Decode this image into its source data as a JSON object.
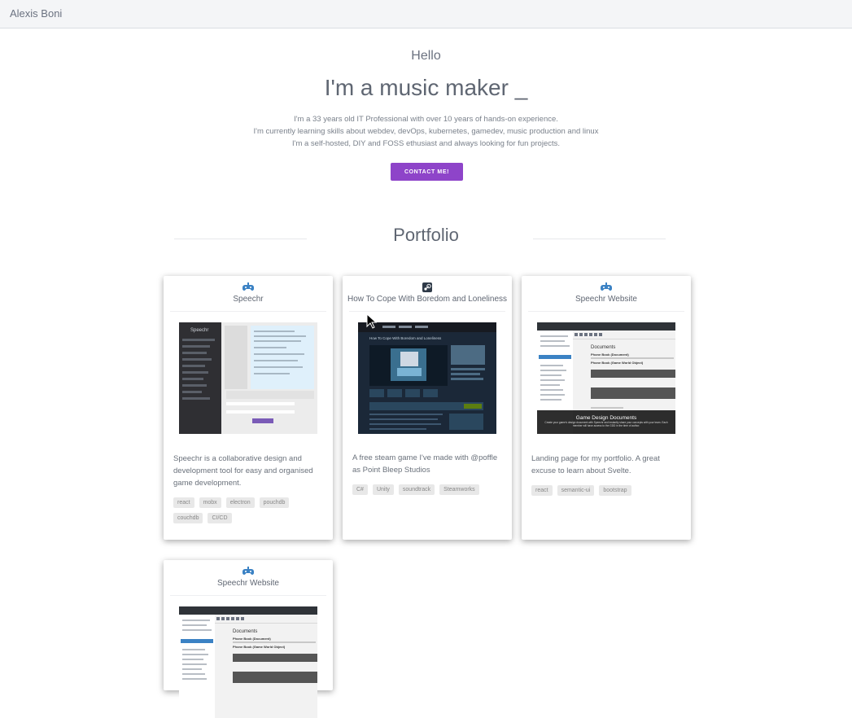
{
  "nav": {
    "brand": "Alexis Boni"
  },
  "hero": {
    "greeting": "Hello",
    "headline": "I'm a music maker _",
    "about": [
      "I'm a 33 years old IT Professional with over 10 years of hands-on experience.",
      "I'm currently learning skills about webdev, devOps, kubernetes, gamedev, music production and linux",
      "I'm a self-hosted, DIY and FOSS ethusiast and always looking for fun projects."
    ],
    "contact_label": "CONTACT ME!"
  },
  "portfolio": {
    "title": "Portfolio",
    "projects": [
      {
        "title": "Speechr",
        "icon": "gamepad-icon",
        "description": "Speechr is a collaborative design and development tool for easy and organised game development.",
        "tags": [
          "react",
          "mobx",
          "electron",
          "pouchdb",
          "couchdb",
          "CI/CD"
        ]
      },
      {
        "title": "How To Cope With Boredom and Loneliness",
        "icon": "steam-icon",
        "description": "A free steam game I've made with @poffle as Point Bleep Studios",
        "tags": [
          "C#",
          "Unity",
          "soundtrack",
          "Steamworks"
        ]
      },
      {
        "title": "Speechr Website",
        "icon": "gamepad-icon",
        "description": "Landing page for my portfolio. A great excuse to learn about Svelte.",
        "tags": [
          "react",
          "semantic-ui",
          "bootstrap"
        ],
        "screenshot_caption": "Game Design Documents",
        "screenshot_subcaption": "Create your game's design document with Speechr and instantly share your concepts with your team. Each member will have access to the GDD in the time of author."
      },
      {
        "title": "Speechr Website",
        "icon": "gamepad-icon"
      }
    ],
    "screens": {
      "speechr_panel": "Speechr",
      "speechr_heading": "Documents",
      "speechr_doc": "Phone Book (Document)",
      "speechr_obj": "Phone Book (Game World Object)",
      "steam_header": "How To Cope With Boredom and Loneliness"
    }
  },
  "colors": {
    "accent": "#8e44c9",
    "icon": "#3b82c4"
  }
}
